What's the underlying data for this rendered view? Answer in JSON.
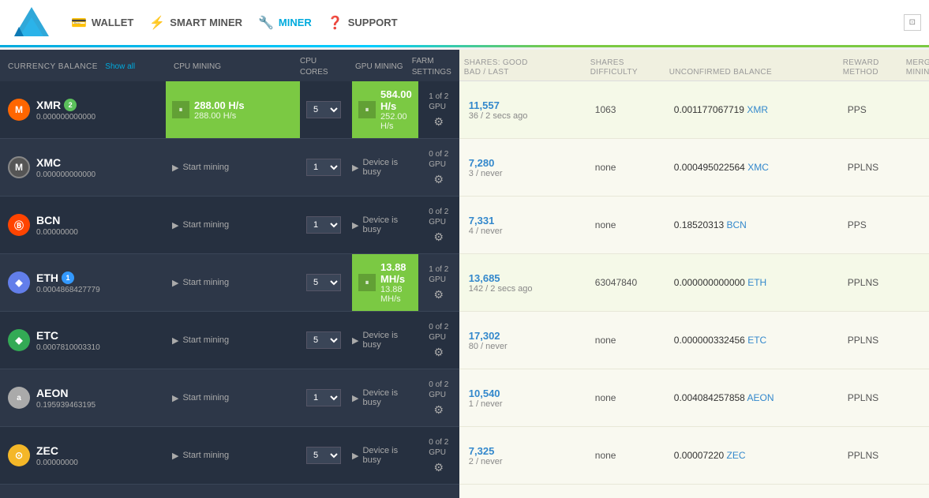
{
  "header": {
    "nav": [
      {
        "id": "wallet",
        "label": "WALLET",
        "icon": "💳",
        "active": false
      },
      {
        "id": "smart-miner",
        "label": "SMART MINER",
        "icon": "⚡",
        "active": false
      },
      {
        "id": "miner",
        "label": "MINER",
        "icon": "🔧",
        "active": true
      },
      {
        "id": "support",
        "label": "SUPPORT",
        "icon": "❓",
        "active": false
      }
    ]
  },
  "columns": {
    "currency_balance": "CURRENCY BALANCE",
    "show_all": "Show all",
    "cpu_mining": "CPU MINING",
    "cpu_cores": "CPU\nCORES",
    "gpu_mining": "GPU MINING",
    "farm_settings": "FARM\nSETTINGS",
    "shares_good_bad": "SHARES: GOOD\nBAD / LAST",
    "shares_difficulty": "SHARES\nDIFFICULTY",
    "unconfirmed_balance": "UNCONFIRMED BALANCE",
    "reward_method": "REWARD\nMETHOD",
    "merged_mining": "MERGED\nMINING"
  },
  "currencies": [
    {
      "id": "XMR",
      "symbol": "M",
      "icon_class": "xmr-icon",
      "balance": "0.000000000000",
      "badge": "2",
      "badge_class": "badge",
      "cpu_active": true,
      "cpu_speed": "288.00 H/s",
      "cpu_speed2": "288.00 H/s",
      "cpu_cores": "5",
      "gpu_active": true,
      "gpu_speed": "584.00 H/s",
      "gpu_speed2": "252.00 H/s",
      "gpu_count": "1 of 2\nGPU",
      "shares_good": "11,557",
      "shares_bad_last": "36 / 2 secs ago",
      "shares_diff": "1063",
      "unconfirmed": "0.001177067719",
      "unconfirmed_cur": "XMR",
      "reward": "PPS",
      "has_eye": true,
      "row_active": true
    },
    {
      "id": "XMC",
      "symbol": "M",
      "icon_class": "xmc-icon",
      "balance": "0.000000000000",
      "badge": null,
      "cpu_active": false,
      "cpu_cores": "1",
      "gpu_active": false,
      "gpu_busy": true,
      "gpu_count": "0 of 2\nGPU",
      "shares_good": "7,280",
      "shares_bad_last": "3 / never",
      "shares_diff": "none",
      "unconfirmed": "0.000495022564",
      "unconfirmed_cur": "XMC",
      "reward": "PPLNS",
      "has_eye": true,
      "row_active": false
    },
    {
      "id": "BCN",
      "symbol": "B",
      "icon_class": "bcn-icon",
      "balance": "0.00000000",
      "badge": null,
      "cpu_active": false,
      "cpu_cores": "1",
      "gpu_active": false,
      "gpu_busy": true,
      "gpu_count": "0 of 2\nGPU",
      "shares_good": "7,331",
      "shares_bad_last": "4 / never",
      "shares_diff": "none",
      "unconfirmed": "0.18520313",
      "unconfirmed_cur": "BCN",
      "reward": "PPS",
      "has_eye": true,
      "row_active": false
    },
    {
      "id": "ETH",
      "symbol": "◆",
      "icon_class": "eth-icon",
      "balance": "0.0004868427779",
      "badge": "1",
      "badge_class": "badge badge-blue",
      "cpu_active": false,
      "cpu_cores": "5",
      "gpu_active": true,
      "gpu_speed": "13.88 MH/s",
      "gpu_speed2": "13.88 MH/s",
      "gpu_count": "1 of 2\nGPU",
      "shares_good": "13,685",
      "shares_bad_last": "142 / 2 secs ago",
      "shares_diff": "63047840",
      "unconfirmed": "0.000000000000",
      "unconfirmed_cur": "ETH",
      "reward": "PPLNS",
      "has_eye": true,
      "row_active": true
    },
    {
      "id": "ETC",
      "symbol": "◆",
      "icon_class": "etc-icon",
      "balance": "0.0007810003310",
      "badge": null,
      "cpu_active": false,
      "cpu_cores": "5",
      "gpu_active": false,
      "gpu_busy": true,
      "gpu_count": "0 of 2\nGPU",
      "shares_good": "17,302",
      "shares_bad_last": "80 / never",
      "shares_diff": "none",
      "unconfirmed": "0.000000332456",
      "unconfirmed_cur": "ETC",
      "reward": "PPLNS",
      "has_eye": true,
      "row_active": false
    },
    {
      "id": "AEON",
      "symbol": "a",
      "icon_class": "aeon-icon",
      "balance": "0.195939463195",
      "badge": null,
      "cpu_active": false,
      "cpu_cores": "1",
      "gpu_active": false,
      "gpu_busy": true,
      "gpu_count": "0 of 2\nGPU",
      "shares_good": "10,540",
      "shares_bad_last": "1 / never",
      "shares_diff": "none",
      "unconfirmed": "0.004084257858",
      "unconfirmed_cur": "AEON",
      "reward": "PPLNS",
      "has_eye": true,
      "row_active": false
    },
    {
      "id": "ZEC",
      "symbol": "⊙",
      "icon_class": "zec-icon",
      "balance": "0.00000000",
      "badge": null,
      "cpu_active": false,
      "cpu_cores": "5",
      "gpu_active": false,
      "gpu_busy": true,
      "gpu_count": "0 of 2\nGPU",
      "shares_good": "7,325",
      "shares_bad_last": "2 / never",
      "shares_diff": "none",
      "unconfirmed": "0.00007220",
      "unconfirmed_cur": "ZEC",
      "reward": "PPLNS",
      "has_eye": true,
      "row_active": false
    }
  ]
}
